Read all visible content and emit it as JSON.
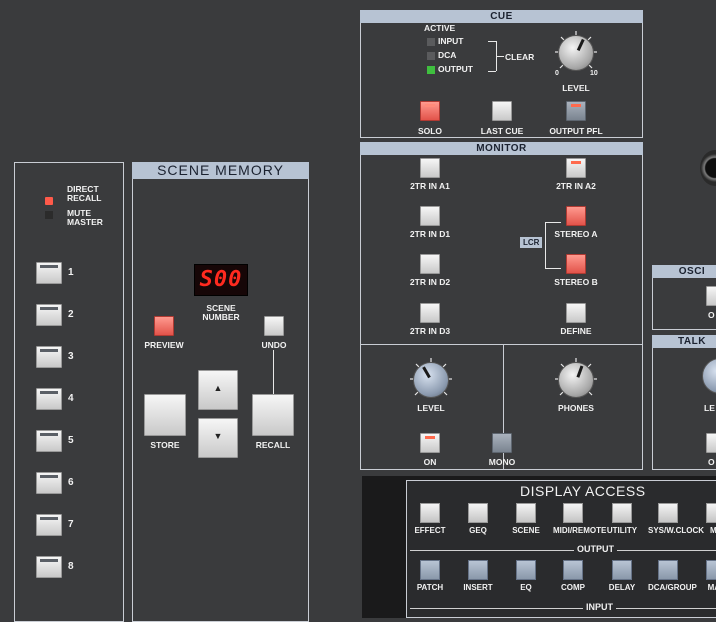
{
  "scene_direct": {
    "direct_recall_label": "DIRECT\nRECALL",
    "mute_master_label": "MUTE\nMASTER",
    "buttons": [
      "1",
      "2",
      "3",
      "4",
      "5",
      "6",
      "7",
      "8"
    ]
  },
  "scene_memory": {
    "title": "SCENE MEMORY",
    "display_value": "S00",
    "scene_number_label": "SCENE\nNUMBER",
    "preview_label": "PREVIEW",
    "undo_label": "UNDO",
    "store_label": "STORE",
    "recall_label": "RECALL",
    "up_label": "▲",
    "down_label": "▼"
  },
  "cue": {
    "title": "CUE",
    "active_label": "ACTIVE",
    "input_label": "INPUT",
    "dca_label": "DCA",
    "output_label": "OUTPUT",
    "clear_label": "CLEAR",
    "level_label": "LEVEL",
    "solo_label": "SOLO",
    "last_cue_label": "LAST CUE",
    "output_pfl_label": "OUTPUT PFL",
    "knob_min": "0",
    "knob_max": "10"
  },
  "monitor": {
    "title": "MONITOR",
    "buttons": {
      "a1": "2TR IN A1",
      "a2": "2TR IN A2",
      "d1": "2TR IN D1",
      "stereo_a": "STEREO A",
      "lcr": "LCR",
      "d2": "2TR IN D2",
      "stereo_b": "STEREO B",
      "d3": "2TR IN D3",
      "define": "DEFINE"
    },
    "level_label": "LEVEL",
    "phones_label": "PHONES",
    "on_label": "ON",
    "mono_label": "MONO"
  },
  "side_panels": {
    "oscillator_title": "OSCI",
    "talkback_title": "TALK",
    "osc_partial": "O",
    "talk_partial_level": "LE",
    "talk_partial_on": "O"
  },
  "display_access": {
    "title": "DISPLAY ACCESS",
    "row1": [
      "EFFECT",
      "GEQ",
      "SCENE",
      "MIDI/REMOTE",
      "UTILITY",
      "SYS/W.CLOCK",
      "ME"
    ],
    "output_label": "OUTPUT",
    "row2": [
      "PATCH",
      "INSERT",
      "EQ",
      "COMP",
      "DELAY",
      "DCA/GROUP",
      "MAT"
    ],
    "input_label": "INPUT"
  },
  "colors": {
    "panel_bg": "#3a3b3d",
    "header_bg": "#b7c3d3",
    "led_red": "#ff2a1f",
    "button_red": "#e2534a",
    "led_green": "#3fbf3f"
  }
}
